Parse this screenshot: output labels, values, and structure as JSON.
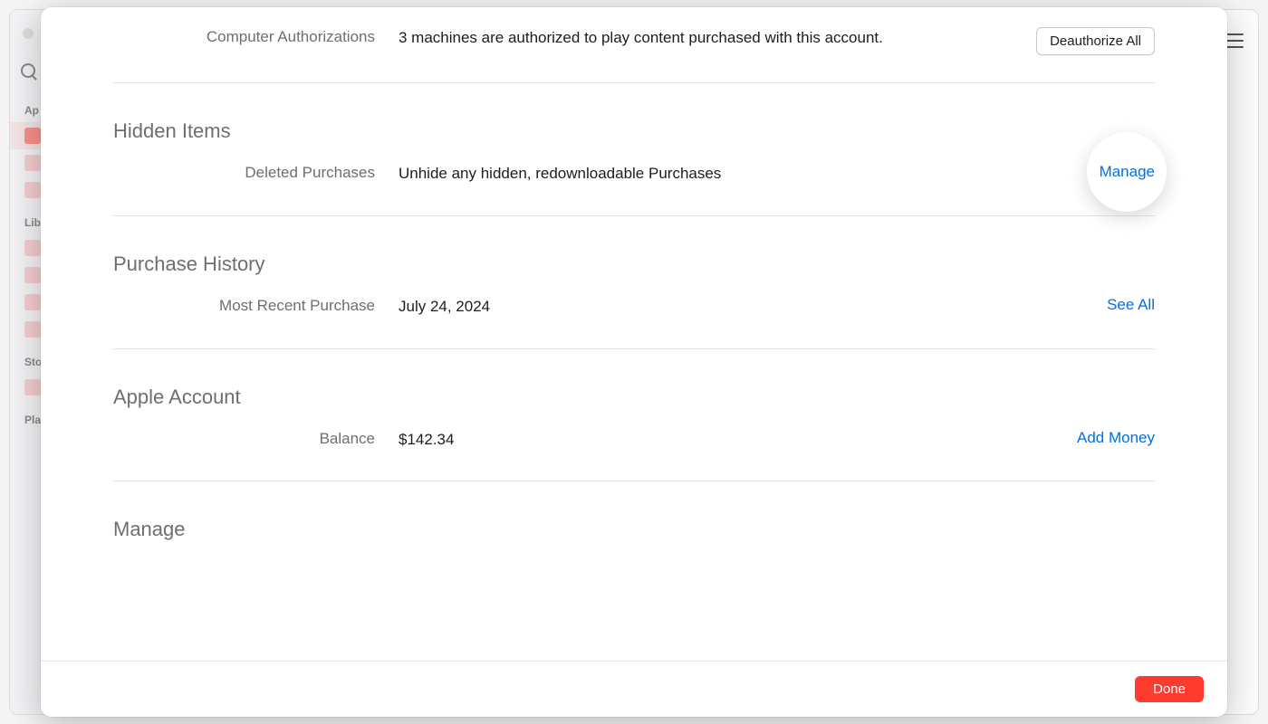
{
  "background": {
    "sections": {
      "apps": "Ap",
      "library": "Lib",
      "store": "Sto",
      "playlists": "Pla"
    }
  },
  "modal": {
    "computerAuth": {
      "label": "Computer Authorizations",
      "value": "3 machines are authorized to play content purchased with this account.",
      "action": "Deauthorize All"
    },
    "hiddenItems": {
      "heading": "Hidden Items",
      "label": "Deleted Purchases",
      "value": "Unhide any hidden, redownloadable Purchases",
      "action": "Manage"
    },
    "purchaseHistory": {
      "heading": "Purchase History",
      "label": "Most Recent Purchase",
      "value": "July 24, 2024",
      "action": "See All"
    },
    "appleAccount": {
      "heading": "Apple Account",
      "label": "Balance",
      "value": "$142.34",
      "action": "Add Money"
    },
    "manage": {
      "heading": "Manage"
    },
    "footer": {
      "done": "Done"
    }
  }
}
